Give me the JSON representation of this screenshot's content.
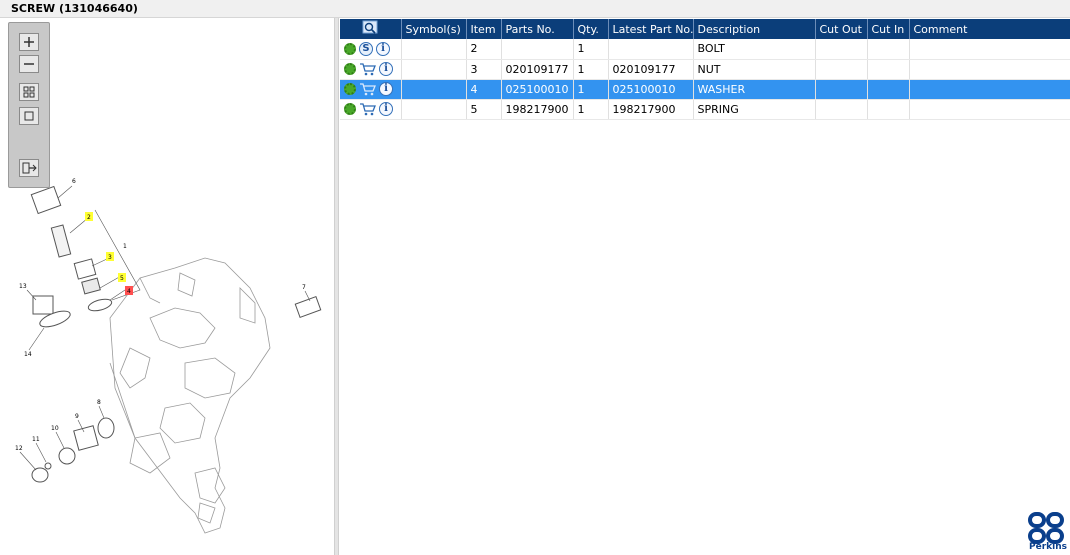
{
  "window": {
    "title": "SCREW (131046640)"
  },
  "colors": {
    "header_bg": "#0b3e7a",
    "selected_row": "#3393f0",
    "gear_green": "#4aa82a",
    "brand_blue": "#0a3f8c"
  },
  "toolbox": {
    "tools": [
      {
        "name": "zoom-in-icon"
      },
      {
        "name": "zoom-out-icon"
      },
      {
        "name": "fit-all-icon"
      },
      {
        "name": "actual-size-icon"
      },
      {
        "name": "export-icon"
      }
    ]
  },
  "diagram": {
    "callouts": [
      "6",
      "2",
      "1",
      "3",
      "5",
      "4",
      "13",
      "14",
      "7",
      "8",
      "9",
      "10",
      "11",
      "12"
    ]
  },
  "table": {
    "columns": [
      "",
      "Symbol(s)",
      "Item",
      "Parts No.",
      "Qty.",
      "Latest Part No.",
      "Description",
      "Cut Out",
      "Cut In",
      "Comment"
    ],
    "rows": [
      {
        "icons": [
          "gear-icon",
          "symbol-s-icon",
          "info-icon"
        ],
        "symbols": "",
        "item": "2",
        "part_no": "",
        "qty": "1",
        "latest": "",
        "desc": "BOLT",
        "cut_out": "",
        "cut_in": "",
        "comment": "",
        "selected": false
      },
      {
        "icons": [
          "gear-icon",
          "cart-icon",
          "info-icon"
        ],
        "symbols": "",
        "item": "3",
        "part_no": "020109177",
        "qty": "1",
        "latest": "020109177",
        "desc": "NUT",
        "cut_out": "",
        "cut_in": "",
        "comment": "",
        "selected": false
      },
      {
        "icons": [
          "gear-icon",
          "cart-icon",
          "info-icon"
        ],
        "symbols": "",
        "item": "4",
        "part_no": "025100010",
        "qty": "1",
        "latest": "025100010",
        "desc": "WASHER",
        "cut_out": "",
        "cut_in": "",
        "comment": "",
        "selected": true
      },
      {
        "icons": [
          "gear-icon",
          "cart-icon",
          "info-icon"
        ],
        "symbols": "",
        "item": "5",
        "part_no": "198217900",
        "qty": "1",
        "latest": "198217900",
        "desc": "SPRING",
        "cut_out": "",
        "cut_in": "",
        "comment": "",
        "selected": false
      }
    ]
  },
  "brand": {
    "name": "Perkins"
  }
}
